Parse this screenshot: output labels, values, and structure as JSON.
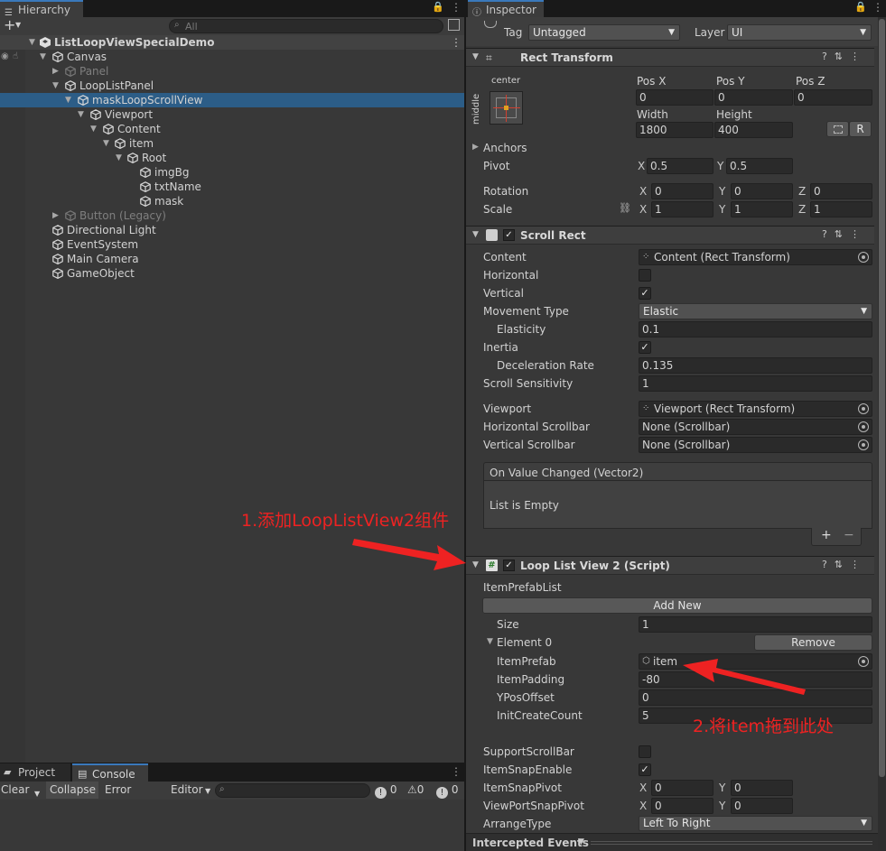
{
  "hierarchy": {
    "tab_label": "Hierarchy",
    "add_label": "+",
    "search_placeholder": "All",
    "scene_name": "ListLoopViewSpecialDemo",
    "items": [
      {
        "label": "Canvas"
      },
      {
        "label": "Panel"
      },
      {
        "label": "LoopListPanel"
      },
      {
        "label": "maskLoopScrollView"
      },
      {
        "label": "Viewport"
      },
      {
        "label": "Content"
      },
      {
        "label": "item"
      },
      {
        "label": "Root"
      },
      {
        "label": "imgBg"
      },
      {
        "label": "txtName"
      },
      {
        "label": "mask"
      },
      {
        "label": "Button (Legacy)"
      },
      {
        "label": "Directional Light"
      },
      {
        "label": "EventSystem"
      },
      {
        "label": "Main Camera"
      },
      {
        "label": "GameObject"
      }
    ]
  },
  "console": {
    "tabs": [
      "Project",
      "Console"
    ],
    "buttons": {
      "clear": "Clear",
      "collapse": "Collapse",
      "error_pause": "Error Pause",
      "editor": "Editor"
    },
    "counts": {
      "info": "0",
      "warn": "0",
      "error": "0"
    }
  },
  "inspector": {
    "tab_label": "Inspector",
    "tag_label": "Tag",
    "tag_value": "Untagged",
    "layer_label": "Layer",
    "layer_value": "UI",
    "rect_transform": {
      "title": "Rect Transform",
      "anchor_h": "center",
      "anchor_v": "middle",
      "posx_label": "Pos X",
      "posx": "0",
      "posy_label": "Pos Y",
      "posy": "0",
      "posz_label": "Pos Z",
      "posz": "0",
      "width_label": "Width",
      "width": "1800",
      "height_label": "Height",
      "height": "400",
      "r_button": "R",
      "anchors_label": "Anchors",
      "pivot_label": "Pivot",
      "pivot_x": "0.5",
      "pivot_y": "0.5",
      "rotation_label": "Rotation",
      "rot_x": "0",
      "rot_y": "0",
      "rot_z": "0",
      "scale_label": "Scale",
      "scale_x": "1",
      "scale_y": "1",
      "scale_z": "1",
      "x": "X",
      "y": "Y",
      "z": "Z"
    },
    "scroll_rect": {
      "title": "Scroll Rect",
      "content_label": "Content",
      "content_value": "Content (Rect Transform)",
      "horizontal_label": "Horizontal",
      "vertical_label": "Vertical",
      "movement_label": "Movement Type",
      "movement_value": "Elastic",
      "elasticity_label": "Elasticity",
      "elasticity_value": "0.1",
      "inertia_label": "Inertia",
      "decel_label": "Deceleration Rate",
      "decel_value": "0.135",
      "sensitivity_label": "Scroll Sensitivity",
      "sensitivity_value": "1",
      "viewport_label": "Viewport",
      "viewport_value": "Viewport (Rect Transform)",
      "hscroll_label": "Horizontal Scrollbar",
      "hscroll_value": "None (Scrollbar)",
      "vscroll_label": "Vertical Scrollbar",
      "vscroll_value": "None (Scrollbar)",
      "event_label": "On Value Changed (Vector2)",
      "event_empty": "List is Empty",
      "plus": "+",
      "minus": "−"
    },
    "loop_list": {
      "title": "Loop List View 2 (Script)",
      "prefab_list_label": "ItemPrefabList",
      "add_new": "Add New",
      "size_label": "Size",
      "size_value": "1",
      "element_label": "Element 0",
      "remove": "Remove",
      "item_prefab_label": "ItemPrefab",
      "item_prefab_value": "item",
      "padding_label": "ItemPadding",
      "padding_value": "-80",
      "ypos_label": "YPosOffset",
      "ypos_value": "0",
      "init_label": "InitCreateCount",
      "init_value": "5",
      "support_scroll_label": "SupportScrollBar",
      "snap_enable_label": "ItemSnapEnable",
      "snap_pivot_label": "ItemSnapPivot",
      "snap_pivot_x": "0",
      "snap_pivot_y": "0",
      "vp_snap_label": "ViewPortSnapPivot",
      "vp_snap_x": "0",
      "vp_snap_y": "0",
      "arrange_label": "ArrangeType",
      "arrange_value": "Left To Right"
    },
    "intercepted": "Intercepted Events"
  },
  "annotations": {
    "step1": "1.添加LoopListView2组件",
    "step2": "2.将item拖到此处"
  },
  "colors": {
    "annotation": "#ee2222",
    "selection": "#2c5d87",
    "accent_tab": "#3a79bb"
  }
}
